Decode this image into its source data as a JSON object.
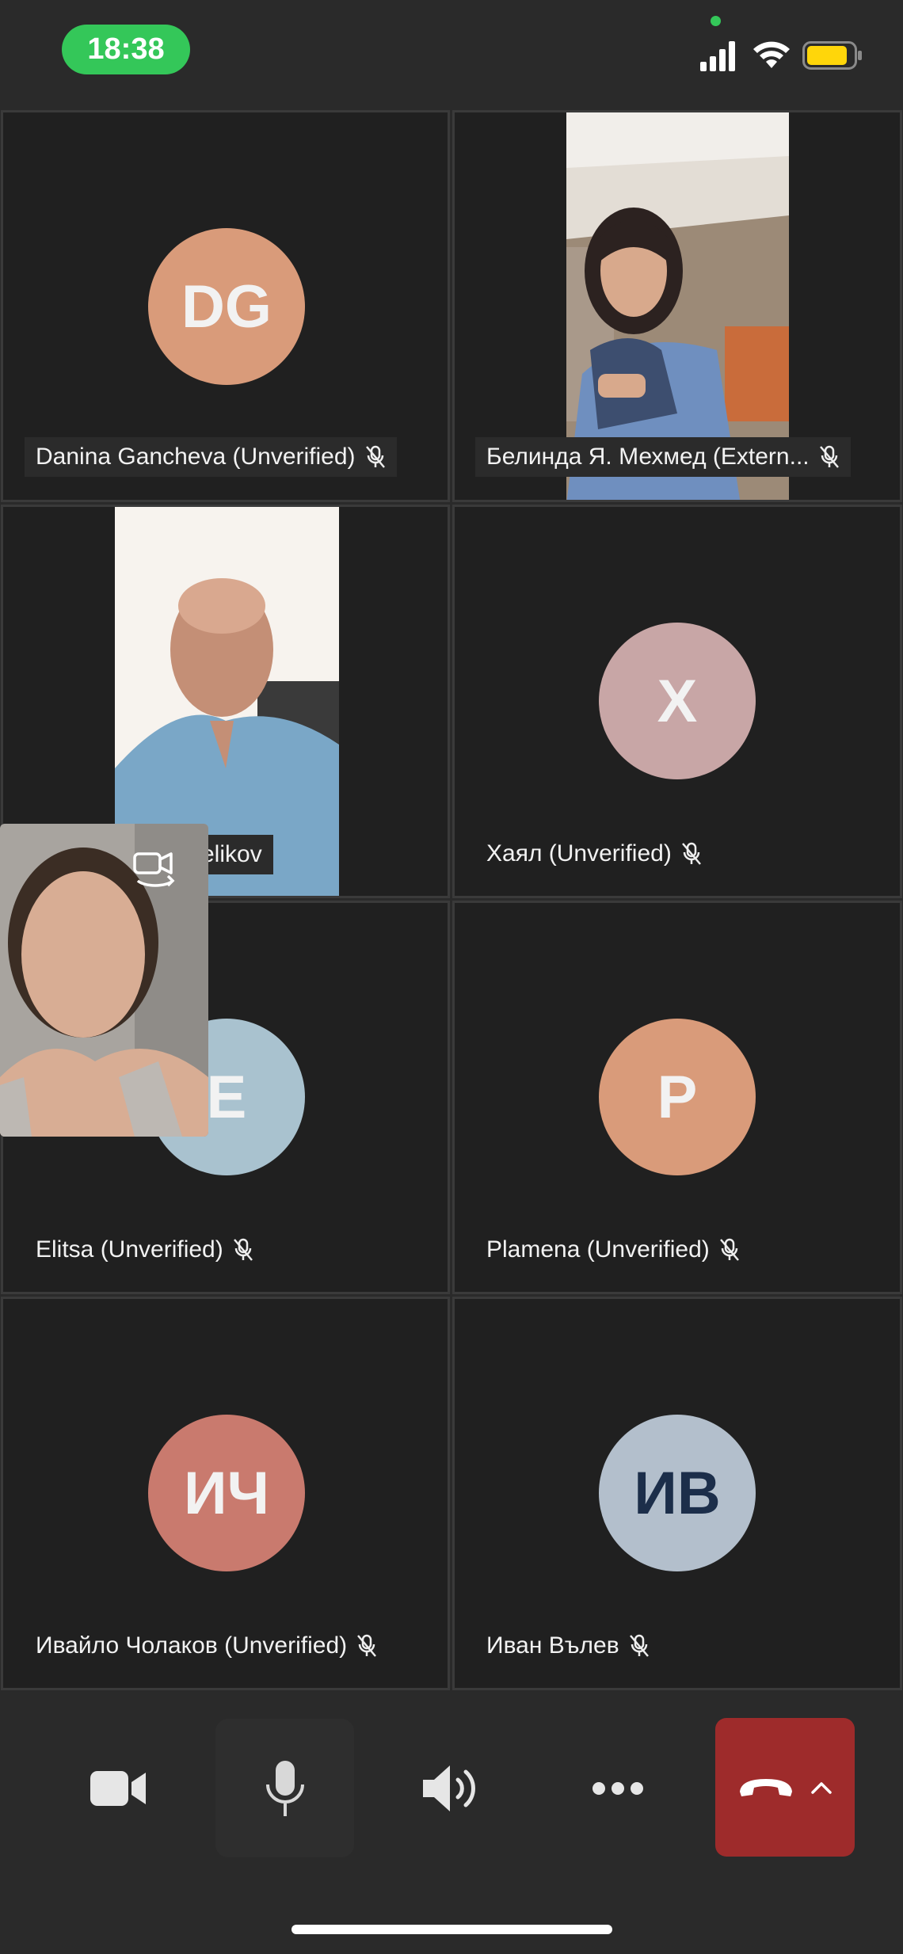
{
  "status_bar": {
    "time": "18:38",
    "icons": [
      "camera-in-use-dot",
      "signal-icon",
      "wifi-icon",
      "battery-icon"
    ],
    "battery_color": "#ffd60a",
    "time_pill_color": "#34c759"
  },
  "participants": [
    {
      "name": "Danina Gancheva (Unverified)",
      "initials": "DG",
      "avatar_color": "#d99b7a",
      "muted": true,
      "video": false
    },
    {
      "name": "Белинда Я. Мехмед (Extern...",
      "initials": "",
      "muted": true,
      "video": true
    },
    {
      "name": "elikov",
      "initials": "",
      "muted": false,
      "video": true
    },
    {
      "name": "Хаял (Unverified)",
      "initials": "Х",
      "avatar_color": "#c8a6a6",
      "muted": true,
      "video": false
    },
    {
      "name": "Elitsa (Unverified)",
      "initials": "E",
      "avatar_color": "#a9c2cf",
      "muted": true,
      "video": false
    },
    {
      "name": "Plamena (Unverified)",
      "initials": "P",
      "avatar_color": "#d99b7a",
      "muted": true,
      "video": false
    },
    {
      "name": "Ивайло Чолаков (Unverified)",
      "initials": "ИЧ",
      "avatar_color": "#c97a6e",
      "muted": true,
      "video": false
    },
    {
      "name": "Иван Вълев",
      "initials": "ИВ",
      "avatar_color": "#b3bfcc",
      "initials_color": "#1c2e4a",
      "muted": true,
      "video": false
    }
  ],
  "controls": {
    "items": [
      "camera-icon",
      "microphone-icon",
      "speaker-icon",
      "more-icon",
      "hang-up-icon",
      "chevron-up-icon"
    ],
    "hangup_color": "#9e2b2b"
  }
}
